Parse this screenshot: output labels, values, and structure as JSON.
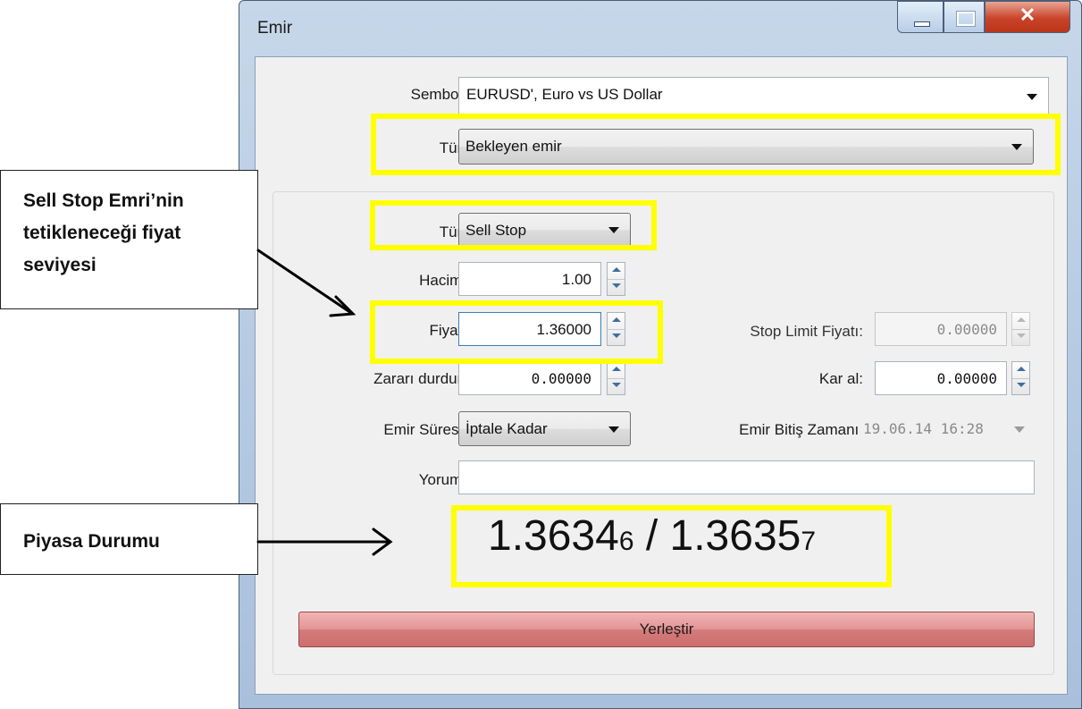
{
  "window": {
    "title": "Emir"
  },
  "form": {
    "symbol": {
      "label": "Sembol:",
      "value": "EURUSD', Euro vs US Dollar"
    },
    "type": {
      "label": "Tür:",
      "value": "Bekleyen emir"
    },
    "order_type": {
      "label": "Tür:",
      "value": "Sell Stop"
    },
    "volume": {
      "label": "Hacim:",
      "value": "1.00"
    },
    "price": {
      "label": "Fiyat:",
      "value": "1.36000"
    },
    "stop_limit": {
      "label": "Stop Limit Fiyatı:",
      "value": "0.00000"
    },
    "stop_loss": {
      "label": "Zararı durdur:",
      "value": "0.00000"
    },
    "take_profit": {
      "label": "Kar al:",
      "value": "0.00000"
    },
    "expiry": {
      "label": "Emir Süresi:",
      "value": "İptale Kadar"
    },
    "expiry_time": {
      "label": "Emir Bitiş Zamanı:",
      "value": "19.06.14 16:28"
    },
    "comment": {
      "label": "Yorum:",
      "value": ""
    },
    "market": {
      "bid_main": "1.3634",
      "bid_small": "6",
      "separator": " / ",
      "ask_main": "1.3635",
      "ask_small": "7"
    },
    "place_button": "Yerleştir"
  },
  "annotations": {
    "sell_stop_note": [
      "Sell Stop Emri’nin",
      "tetikleneceği fiyat",
      "seviyesi"
    ],
    "market_note": "Piyasa Durumu",
    "highlight_color": "#ffff00"
  }
}
